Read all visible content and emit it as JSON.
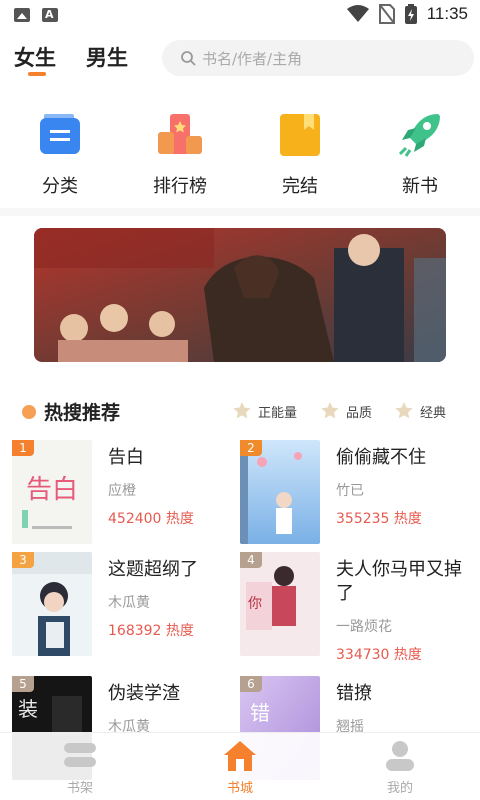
{
  "status_bar": {
    "time": "11:35"
  },
  "header": {
    "tabs": [
      {
        "label": "女生",
        "active": true
      },
      {
        "label": "男生",
        "active": false
      }
    ],
    "search_placeholder": "书名/作者/主角"
  },
  "quick_nav": [
    {
      "label": "分类",
      "icon": "category-icon"
    },
    {
      "label": "排行榜",
      "icon": "ranking-icon"
    },
    {
      "label": "完结",
      "icon": "finished-book-icon"
    },
    {
      "label": "新书",
      "icon": "rocket-icon"
    }
  ],
  "hot_section": {
    "title": "热搜推荐",
    "tags": [
      "正能量",
      "品质",
      "经典"
    ],
    "heat_suffix": "热度",
    "books": [
      {
        "rank": "1",
        "title": "告白",
        "author": "应橙",
        "heat": "452400"
      },
      {
        "rank": "2",
        "title": "偷偷藏不住",
        "author": "竹已",
        "heat": "355235"
      },
      {
        "rank": "3",
        "title": "这题超纲了",
        "author": "木瓜黄",
        "heat": "168392"
      },
      {
        "rank": "4",
        "title": "夫人你马甲又掉了",
        "author": "一路烦花",
        "heat": "334730"
      },
      {
        "rank": "5",
        "title": "伪装学渣",
        "author": "木瓜黄",
        "heat": ""
      },
      {
        "rank": "6",
        "title": "错撩",
        "author": "翘摇",
        "heat": ""
      }
    ]
  },
  "bottom_nav": [
    {
      "label": "书架",
      "active": false
    },
    {
      "label": "书城",
      "active": true
    },
    {
      "label": "我的",
      "active": false
    }
  ],
  "colors": {
    "accent": "#f5802e",
    "heat": "#e85a4f",
    "rank_colors": [
      "#f5802e",
      "#f08a2b",
      "#f5a342",
      "#b6a08f",
      "#b6a08f",
      "#b6a08f"
    ]
  }
}
